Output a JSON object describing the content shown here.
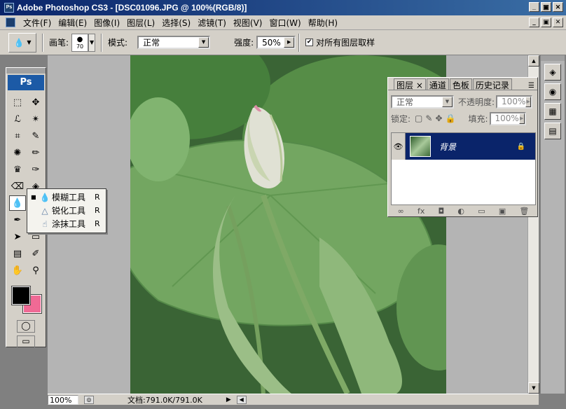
{
  "titlebar": {
    "title": "Adobe Photoshop CS3 - [DSC01096.JPG @ 100%(RGB/8)]",
    "ps_badge": "Ps",
    "min": "_",
    "max": "▣",
    "close": "✕"
  },
  "menu": {
    "items": [
      "文件(F)",
      "编辑(E)",
      "图像(I)",
      "图层(L)",
      "选择(S)",
      "滤镜(T)",
      "视图(V)",
      "窗口(W)",
      "帮助(H)"
    ],
    "doc_min": "_",
    "doc_max": "▣",
    "doc_close": "✕"
  },
  "options": {
    "brush_label": "画笔:",
    "brush_size": "70",
    "mode_label": "模式:",
    "mode_value": "正常",
    "strength_label": "强度:",
    "strength_value": "50%",
    "sample_all": "对所有图层取样",
    "sample_checked": "✔"
  },
  "toolbox": {
    "logo": "Ps",
    "tools": [
      {
        "name": "marquee-tool-icon",
        "glyph": "⬚"
      },
      {
        "name": "move-tool-icon",
        "glyph": "✥"
      },
      {
        "name": "lasso-tool-icon",
        "glyph": "ℒ"
      },
      {
        "name": "magic-wand-tool-icon",
        "glyph": "✴"
      },
      {
        "name": "crop-tool-icon",
        "glyph": "⌗"
      },
      {
        "name": "slice-tool-icon",
        "glyph": "✎"
      },
      {
        "name": "healing-brush-tool-icon",
        "glyph": "✺"
      },
      {
        "name": "brush-tool-icon",
        "glyph": "✏"
      },
      {
        "name": "clone-stamp-tool-icon",
        "glyph": "♛"
      },
      {
        "name": "history-brush-tool-icon",
        "glyph": "✑"
      },
      {
        "name": "eraser-tool-icon",
        "glyph": "⌫"
      },
      {
        "name": "paint-bucket-tool-icon",
        "glyph": "◈"
      },
      {
        "name": "blur-tool-icon",
        "glyph": "💧"
      },
      {
        "name": "dodge-tool-icon",
        "glyph": "●"
      },
      {
        "name": "pen-tool-icon",
        "glyph": "✒"
      },
      {
        "name": "type-tool-icon",
        "glyph": "T"
      },
      {
        "name": "path-selection-tool-icon",
        "glyph": "➤"
      },
      {
        "name": "shape-tool-icon",
        "glyph": "▭"
      },
      {
        "name": "notes-tool-icon",
        "glyph": "▤"
      },
      {
        "name": "eyedropper-tool-icon",
        "glyph": "✐"
      },
      {
        "name": "hand-tool-icon",
        "glyph": "✋"
      },
      {
        "name": "zoom-tool-icon",
        "glyph": "⚲"
      }
    ],
    "quick_mask": "◯",
    "screen_mode": "▭"
  },
  "flyout": {
    "items": [
      {
        "label": "模糊工具",
        "key": "R",
        "active": "■",
        "icon": "💧"
      },
      {
        "label": "锐化工具",
        "key": "R",
        "active": "",
        "icon": "△"
      },
      {
        "label": "涂抹工具",
        "key": "R",
        "active": "",
        "icon": "☝"
      }
    ]
  },
  "layers": {
    "tabs": [
      "图层 ×",
      "通道",
      "色板",
      "历史记录"
    ],
    "blend_mode": "正常",
    "opacity_label": "不透明度:",
    "opacity_value": "100%",
    "lock_label": "锁定:",
    "fill_label": "填充:",
    "fill_value": "100%",
    "layer_name": "背景",
    "footer_icons": [
      "∞",
      "fx",
      "◘",
      "◐",
      "▭",
      "▣",
      "🗑"
    ]
  },
  "status": {
    "zoom": "100%",
    "doc_info": "文档:791.0K/791.0K"
  },
  "colors": {
    "foreground": "#000000",
    "background": "#f06a95"
  }
}
